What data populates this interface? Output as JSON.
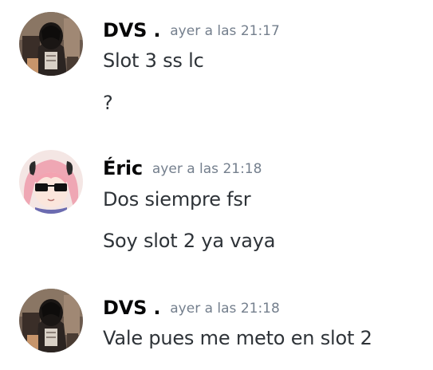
{
  "messages": [
    {
      "author": "DVS .",
      "timestamp": "ayer a las 21:17",
      "avatar_icon": "hooded-figure-avatar",
      "lines": [
        "Slot 3 ss lc",
        "?"
      ]
    },
    {
      "author": "Éric",
      "timestamp": "ayer a las 21:18",
      "avatar_icon": "pink-hair-sunglasses-avatar",
      "lines": [
        "Dos siempre fsr",
        "Soy slot 2 ya vaya"
      ]
    },
    {
      "author": "DVS .",
      "timestamp": "ayer a las 21:18",
      "avatar_icon": "hooded-figure-avatar",
      "lines": [
        "Vale pues me meto en slot 2"
      ]
    }
  ],
  "colors": {
    "background": "#ffffff",
    "username": "#060607",
    "timestamp": "#747f8d",
    "message_text": "#2e3338"
  }
}
